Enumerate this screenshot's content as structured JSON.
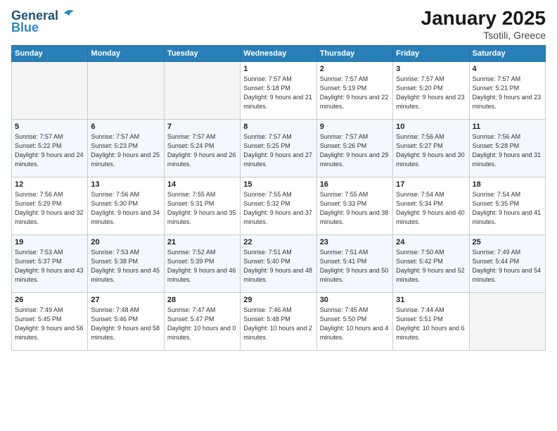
{
  "header": {
    "logo_line1": "General",
    "logo_line2": "Blue",
    "title": "January 2025",
    "subtitle": "Tsotili, Greece"
  },
  "columns": [
    "Sunday",
    "Monday",
    "Tuesday",
    "Wednesday",
    "Thursday",
    "Friday",
    "Saturday"
  ],
  "weeks": [
    [
      {
        "day": "",
        "sunrise": "",
        "sunset": "",
        "daylight": "",
        "empty": true
      },
      {
        "day": "",
        "sunrise": "",
        "sunset": "",
        "daylight": "",
        "empty": true
      },
      {
        "day": "",
        "sunrise": "",
        "sunset": "",
        "daylight": "",
        "empty": true
      },
      {
        "day": "1",
        "sunrise": "7:57 AM",
        "sunset": "5:18 PM",
        "daylight": "9 hours and 21 minutes."
      },
      {
        "day": "2",
        "sunrise": "7:57 AM",
        "sunset": "5:19 PM",
        "daylight": "9 hours and 22 minutes."
      },
      {
        "day": "3",
        "sunrise": "7:57 AM",
        "sunset": "5:20 PM",
        "daylight": "9 hours and 23 minutes."
      },
      {
        "day": "4",
        "sunrise": "7:57 AM",
        "sunset": "5:21 PM",
        "daylight": "9 hours and 23 minutes."
      }
    ],
    [
      {
        "day": "5",
        "sunrise": "7:57 AM",
        "sunset": "5:22 PM",
        "daylight": "9 hours and 24 minutes."
      },
      {
        "day": "6",
        "sunrise": "7:57 AM",
        "sunset": "5:23 PM",
        "daylight": "9 hours and 25 minutes."
      },
      {
        "day": "7",
        "sunrise": "7:57 AM",
        "sunset": "5:24 PM",
        "daylight": "9 hours and 26 minutes."
      },
      {
        "day": "8",
        "sunrise": "7:57 AM",
        "sunset": "5:25 PM",
        "daylight": "9 hours and 27 minutes."
      },
      {
        "day": "9",
        "sunrise": "7:57 AM",
        "sunset": "5:26 PM",
        "daylight": "9 hours and 29 minutes."
      },
      {
        "day": "10",
        "sunrise": "7:56 AM",
        "sunset": "5:27 PM",
        "daylight": "9 hours and 30 minutes."
      },
      {
        "day": "11",
        "sunrise": "7:56 AM",
        "sunset": "5:28 PM",
        "daylight": "9 hours and 31 minutes."
      }
    ],
    [
      {
        "day": "12",
        "sunrise": "7:56 AM",
        "sunset": "5:29 PM",
        "daylight": "9 hours and 32 minutes."
      },
      {
        "day": "13",
        "sunrise": "7:56 AM",
        "sunset": "5:30 PM",
        "daylight": "9 hours and 34 minutes."
      },
      {
        "day": "14",
        "sunrise": "7:55 AM",
        "sunset": "5:31 PM",
        "daylight": "9 hours and 35 minutes."
      },
      {
        "day": "15",
        "sunrise": "7:55 AM",
        "sunset": "5:32 PM",
        "daylight": "9 hours and 37 minutes."
      },
      {
        "day": "16",
        "sunrise": "7:55 AM",
        "sunset": "5:33 PM",
        "daylight": "9 hours and 38 minutes."
      },
      {
        "day": "17",
        "sunrise": "7:54 AM",
        "sunset": "5:34 PM",
        "daylight": "9 hours and 40 minutes."
      },
      {
        "day": "18",
        "sunrise": "7:54 AM",
        "sunset": "5:35 PM",
        "daylight": "9 hours and 41 minutes."
      }
    ],
    [
      {
        "day": "19",
        "sunrise": "7:53 AM",
        "sunset": "5:37 PM",
        "daylight": "9 hours and 43 minutes."
      },
      {
        "day": "20",
        "sunrise": "7:53 AM",
        "sunset": "5:38 PM",
        "daylight": "9 hours and 45 minutes."
      },
      {
        "day": "21",
        "sunrise": "7:52 AM",
        "sunset": "5:39 PM",
        "daylight": "9 hours and 46 minutes."
      },
      {
        "day": "22",
        "sunrise": "7:51 AM",
        "sunset": "5:40 PM",
        "daylight": "9 hours and 48 minutes."
      },
      {
        "day": "23",
        "sunrise": "7:51 AM",
        "sunset": "5:41 PM",
        "daylight": "9 hours and 50 minutes."
      },
      {
        "day": "24",
        "sunrise": "7:50 AM",
        "sunset": "5:42 PM",
        "daylight": "9 hours and 52 minutes."
      },
      {
        "day": "25",
        "sunrise": "7:49 AM",
        "sunset": "5:44 PM",
        "daylight": "9 hours and 54 minutes."
      }
    ],
    [
      {
        "day": "26",
        "sunrise": "7:49 AM",
        "sunset": "5:45 PM",
        "daylight": "9 hours and 56 minutes."
      },
      {
        "day": "27",
        "sunrise": "7:48 AM",
        "sunset": "5:46 PM",
        "daylight": "9 hours and 58 minutes."
      },
      {
        "day": "28",
        "sunrise": "7:47 AM",
        "sunset": "5:47 PM",
        "daylight": "10 hours and 0 minutes."
      },
      {
        "day": "29",
        "sunrise": "7:46 AM",
        "sunset": "5:48 PM",
        "daylight": "10 hours and 2 minutes."
      },
      {
        "day": "30",
        "sunrise": "7:45 AM",
        "sunset": "5:50 PM",
        "daylight": "10 hours and 4 minutes."
      },
      {
        "day": "31",
        "sunrise": "7:44 AM",
        "sunset": "5:51 PM",
        "daylight": "10 hours and 6 minutes."
      },
      {
        "day": "",
        "sunrise": "",
        "sunset": "",
        "daylight": "",
        "empty": true
      }
    ]
  ]
}
